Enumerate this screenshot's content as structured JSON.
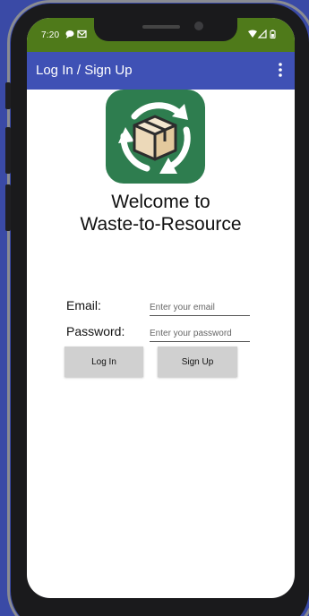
{
  "status_bar": {
    "time": "7:20",
    "left_icons": [
      "chat-bubble-icon",
      "mail-icon"
    ],
    "right_icons": [
      "wifi-icon",
      "signal-icon",
      "battery-icon"
    ],
    "background": "#4f7a1a"
  },
  "app_bar": {
    "title": "Log In / Sign Up",
    "menu_icon": "more-vert-icon",
    "background": "#3f51b5"
  },
  "logo": {
    "icon": "recycle-box-icon",
    "background": "#2e7d4f"
  },
  "welcome": {
    "line1": "Welcome to",
    "line2": "Waste-to-Resource"
  },
  "form": {
    "email_label": "Email:",
    "email_placeholder": "Enter your email",
    "email_value": "",
    "password_label": "Password:",
    "password_placeholder": "Enter your password",
    "password_value": ""
  },
  "buttons": {
    "login_label": "Log In",
    "signup_label": "Sign Up"
  }
}
